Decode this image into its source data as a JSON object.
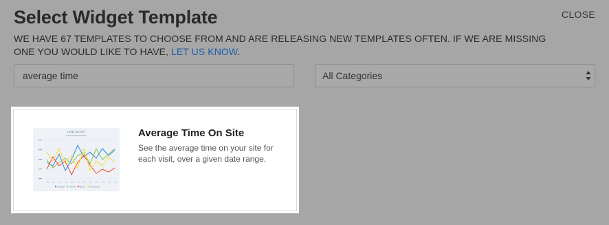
{
  "modal": {
    "title": "Select Widget Template",
    "close_label": "CLOSE",
    "description_part1": "WE HAVE 67 TEMPLATES TO CHOOSE FROM AND ARE RELEASING NEW TEMPLATES OFTEN. IF WE ARE MISSING ONE YOU WOULD LIKE TO HAVE, ",
    "description_link": "LET US KNOW",
    "description_end": "."
  },
  "filters": {
    "search_value": "average time",
    "category_selected": "All Categories"
  },
  "results": [
    {
      "title": "Average Time On Site",
      "description": "See the average time on your site for each visit, over a given date range.",
      "thumbnail": {
        "chart_title": "LINE CHART",
        "legend": [
          "Google",
          "Yahoo",
          "Bing",
          "Facebook"
        ]
      }
    }
  ],
  "colors": {
    "overlay": "#a6a6a6",
    "link": "#1a5fa8",
    "series": [
      "#2e86de",
      "#8bc34a",
      "#f44336",
      "#fdd835"
    ]
  }
}
